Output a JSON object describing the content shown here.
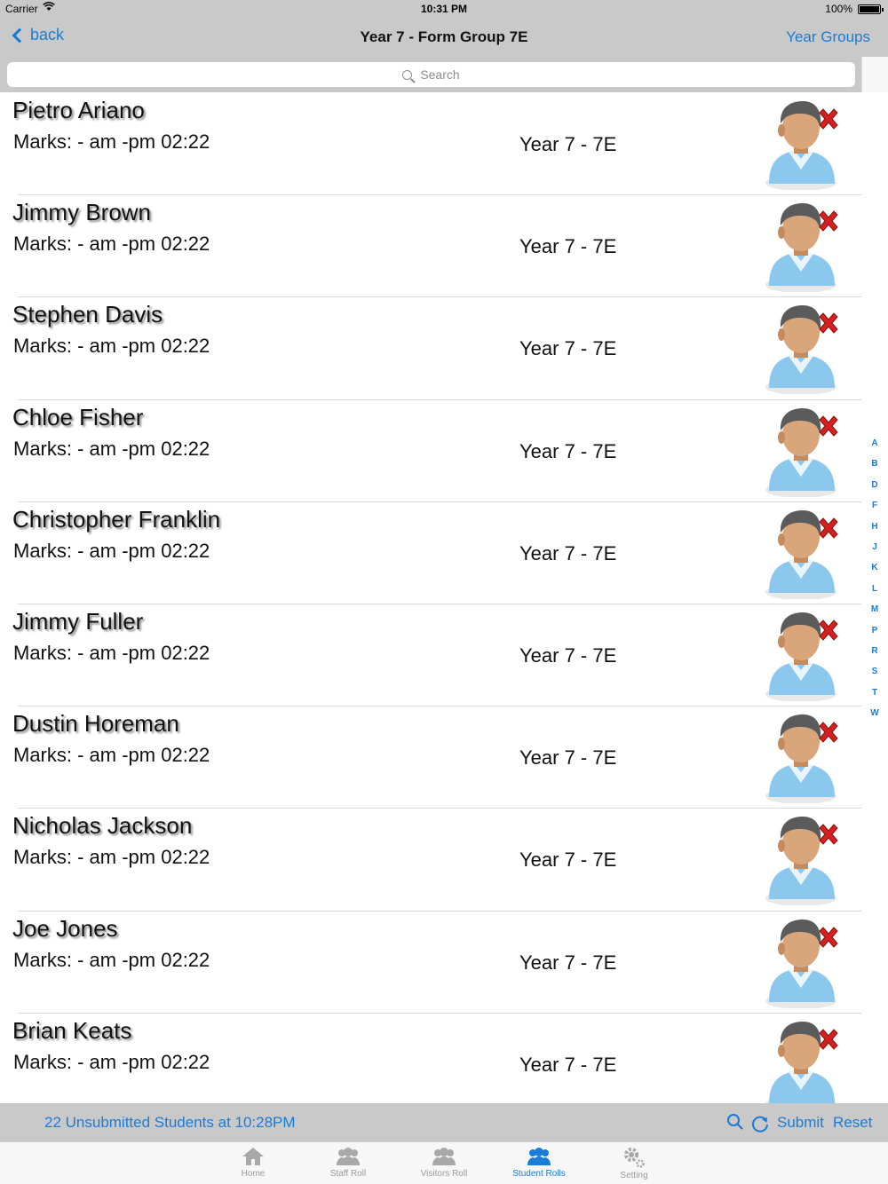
{
  "status_bar": {
    "carrier": "Carrier",
    "time": "10:31 PM",
    "battery": "100%"
  },
  "nav": {
    "back_label": "back",
    "title": "Year  7 - Form Group 7E",
    "right_label": "Year Groups"
  },
  "search": {
    "placeholder": "Search"
  },
  "students": [
    {
      "name": "Pietro Ariano",
      "marks": "Marks: - am -pm 02:22",
      "group": "Year  7 - 7E"
    },
    {
      "name": "Jimmy Brown",
      "marks": "Marks: - am -pm 02:22",
      "group": "Year  7 - 7E"
    },
    {
      "name": "Stephen Davis",
      "marks": "Marks: - am -pm 02:22",
      "group": "Year  7 - 7E"
    },
    {
      "name": "Chloe Fisher",
      "marks": "Marks: - am -pm 02:22",
      "group": "Year  7 - 7E"
    },
    {
      "name": "Christopher Franklin",
      "marks": "Marks: - am -pm 02:22",
      "group": "Year  7 - 7E"
    },
    {
      "name": "Jimmy Fuller",
      "marks": "Marks: - am -pm 02:22",
      "group": "Year  7 - 7E"
    },
    {
      "name": "Dustin Horeman",
      "marks": "Marks: - am -pm 02:22",
      "group": "Year  7 - 7E"
    },
    {
      "name": "Nicholas Jackson",
      "marks": "Marks: - am -pm 02:22",
      "group": "Year  7 - 7E"
    },
    {
      "name": "Joe Jones",
      "marks": "Marks: - am -pm 02:22",
      "group": "Year  7 - 7E"
    },
    {
      "name": "Brian Keats",
      "marks": "Marks: - am -pm 02:22",
      "group": "Year  7 - 7E"
    }
  ],
  "index_letters": [
    "A",
    "B",
    "D",
    "F",
    "H",
    "J",
    "K",
    "L",
    "M",
    "P",
    "R",
    "S",
    "T",
    "W"
  ],
  "toolbar": {
    "unsubmitted": "22 Unsubmitted Students at 10:28PM",
    "submit_label": "Submit",
    "reset_label": "Reset"
  },
  "tabs": [
    {
      "label": "Home",
      "icon": "home-icon",
      "active": false
    },
    {
      "label": "Staff Roll",
      "icon": "staff-icon",
      "active": false
    },
    {
      "label": "Visitors Roll",
      "icon": "visitors-icon",
      "active": false
    },
    {
      "label": "Student Rolls",
      "icon": "students-icon",
      "active": true
    },
    {
      "label": "Setting",
      "icon": "gear-icon",
      "active": false
    }
  ],
  "colors": {
    "accent": "#1a7bd8",
    "bar": "#c9c9c9",
    "absent_mark": "#d32020"
  }
}
